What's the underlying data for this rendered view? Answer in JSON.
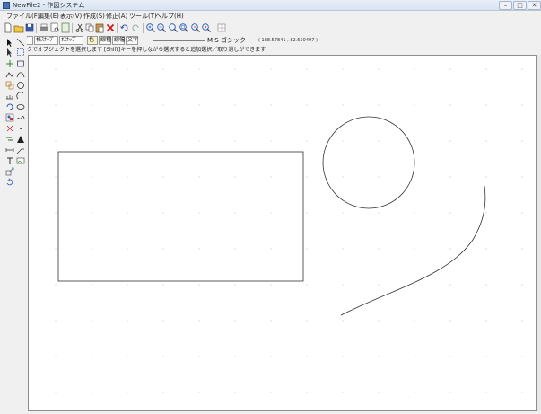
{
  "window": {
    "title": "NewFile2 - 作図システム",
    "buttons": [
      "–",
      "□",
      "✕"
    ]
  },
  "menu": {
    "items": [
      {
        "id": "file",
        "label": "ファイル(F)"
      },
      {
        "id": "edit",
        "label": "編集(E)"
      },
      {
        "id": "view",
        "label": "表示(V)"
      },
      {
        "id": "create",
        "label": "作成(S)"
      },
      {
        "id": "modify",
        "label": "修正(A)"
      },
      {
        "id": "tools",
        "label": "ツール(T)"
      },
      {
        "id": "help",
        "label": "ヘルプ(H)"
      }
    ]
  },
  "toolbar": {
    "icons": [
      "new-file-icon",
      "open-folder-icon",
      "save-icon",
      "print-icon",
      "print-preview-icon",
      "document-icon",
      "cut-icon",
      "copy-icon",
      "paste-icon",
      "delete-icon",
      "undo-icon",
      "redo-icon",
      "zoom-in-icon",
      "zoom-out-icon",
      "zoom-fit-icon",
      "zoom-window-icon",
      "zoom-previous-icon",
      "zoom-all-icon",
      "grid-icon"
    ]
  },
  "toolbar2": {
    "buttons": [
      {
        "id": "grid",
        "label": "ｸﾞﾘｯﾄﾞ"
      },
      {
        "id": "snap",
        "label": "格ｽﾅｯﾌﾟ"
      },
      {
        "id": "osnap",
        "label": "ｵｽﾅｯﾌﾟ"
      },
      {
        "id": "color",
        "label": "色"
      },
      {
        "id": "linetype",
        "label": "線種"
      },
      {
        "id": "linewidth",
        "label": "線幅"
      },
      {
        "id": "text",
        "label": "文字"
      }
    ],
    "font_label": "M S  ゴシック",
    "coords": "( 188.57841 , 82.650497 )"
  },
  "status": {
    "hint": "左クリックでオブジェクトを選択します [Shift]キーを押しながら選択すると追加選択／取り消しができます"
  },
  "left_tools": {
    "icons": [
      "select-arrow-icon",
      "line-tool-icon",
      "select-arrow-2-icon",
      "rectangle-select-icon",
      "move-icon",
      "box-icon",
      "polyline-icon",
      "curve-icon",
      "copy-object-icon",
      "circle-tool-icon",
      "measure-icon",
      "arc-tool-icon",
      "undo-arc-icon",
      "ellipse-icon",
      "group-icon",
      "spline-icon",
      "point-icon",
      "dot-icon",
      "fill-icon",
      "hatch-icon",
      "dimension-icon",
      "leader-icon",
      "text-icon",
      "image-icon",
      "scale-icon",
      "rotate-icon"
    ]
  },
  "colors": {
    "canvas_bg": "#ffffff",
    "shape_stroke": "#333333",
    "grid_dot": "#c8c8c8",
    "window_bg": "#f0f0f0",
    "accent": "#4a70b0"
  }
}
